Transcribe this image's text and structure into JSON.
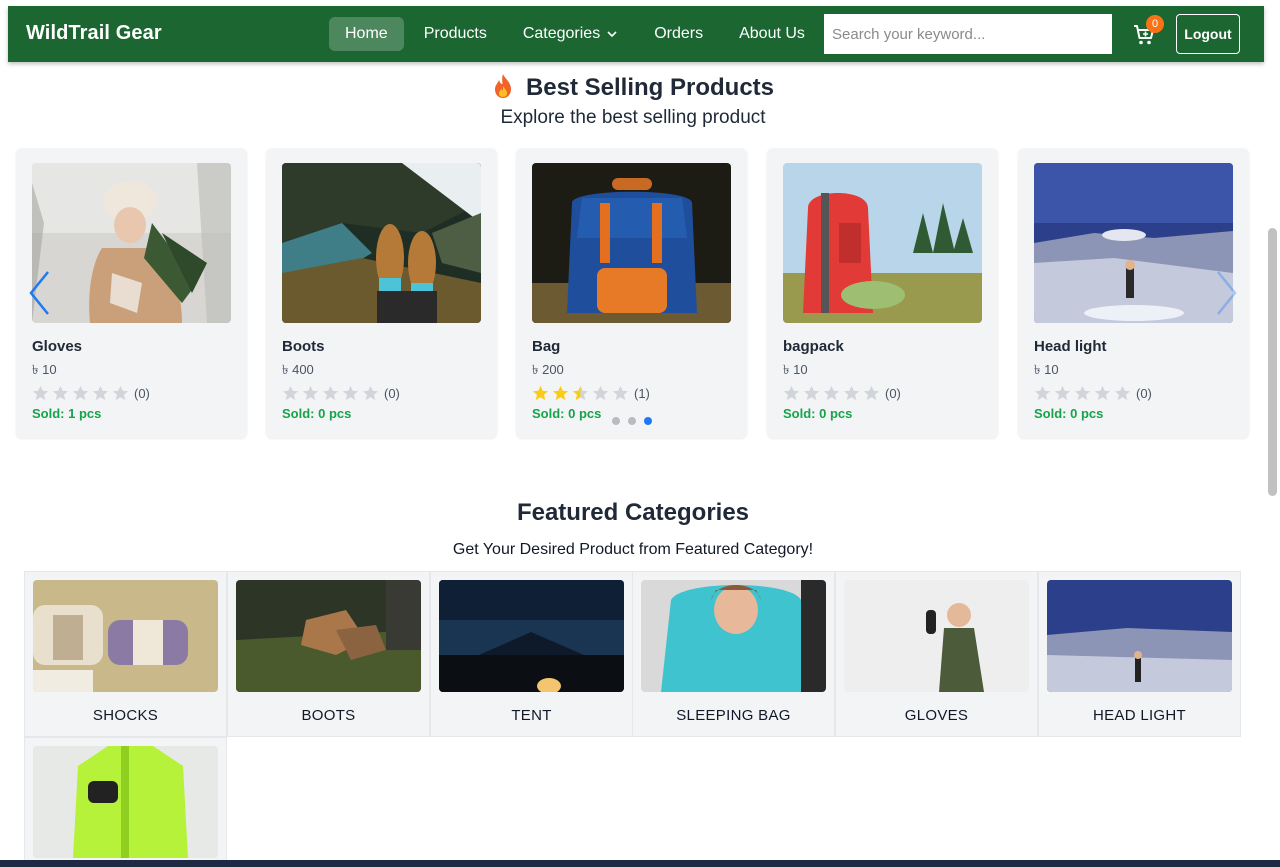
{
  "navbar": {
    "brand": "WildTrail Gear",
    "links": [
      {
        "label": "Home",
        "active": true
      },
      {
        "label": "Products"
      },
      {
        "label": "Categories",
        "dropdown": true
      },
      {
        "label": "Orders"
      },
      {
        "label": "About Us"
      }
    ],
    "search_placeholder": "Search your keyword...",
    "cart_count": "0",
    "logout_label": "Logout"
  },
  "best_selling": {
    "title": "Best Selling Products",
    "subtitle": "Explore the best selling product",
    "products": [
      {
        "name": "Gloves",
        "price": "৳ 10",
        "rating": 0,
        "reviews": "(0)",
        "sold": "Sold: 1 pcs"
      },
      {
        "name": "Boots",
        "price": "৳ 400",
        "rating": 0,
        "reviews": "(0)",
        "sold": "Sold: 0 pcs"
      },
      {
        "name": "Bag",
        "price": "৳ 200",
        "rating": 2.5,
        "reviews": "(1)",
        "sold": "Sold: 0 pcs"
      },
      {
        "name": "bagpack",
        "price": "৳ 10",
        "rating": 0,
        "reviews": "(0)",
        "sold": "Sold: 0 pcs"
      },
      {
        "name": "Head light",
        "price": "৳ 10",
        "rating": 0,
        "reviews": "(0)",
        "sold": "Sold: 0 pcs"
      }
    ],
    "carousel_pages": 3,
    "active_page": 3
  },
  "featured": {
    "title": "Featured Categories",
    "subtitle": "Get Your Desired Product from Featured Category!",
    "categories": [
      {
        "label": "SHOCKS"
      },
      {
        "label": "BOOTS"
      },
      {
        "label": "TENT"
      },
      {
        "label": "SLEEPING BAG"
      },
      {
        "label": "GLOVES"
      },
      {
        "label": "HEAD LIGHT"
      },
      {
        "label": ""
      }
    ]
  },
  "colors": {
    "navbar": "#1b6631",
    "sold_text": "#16a34a",
    "star_filled": "#facc15",
    "star_empty": "#d1d5db",
    "badge": "#f97316",
    "dot_active": "#1d7af3"
  }
}
